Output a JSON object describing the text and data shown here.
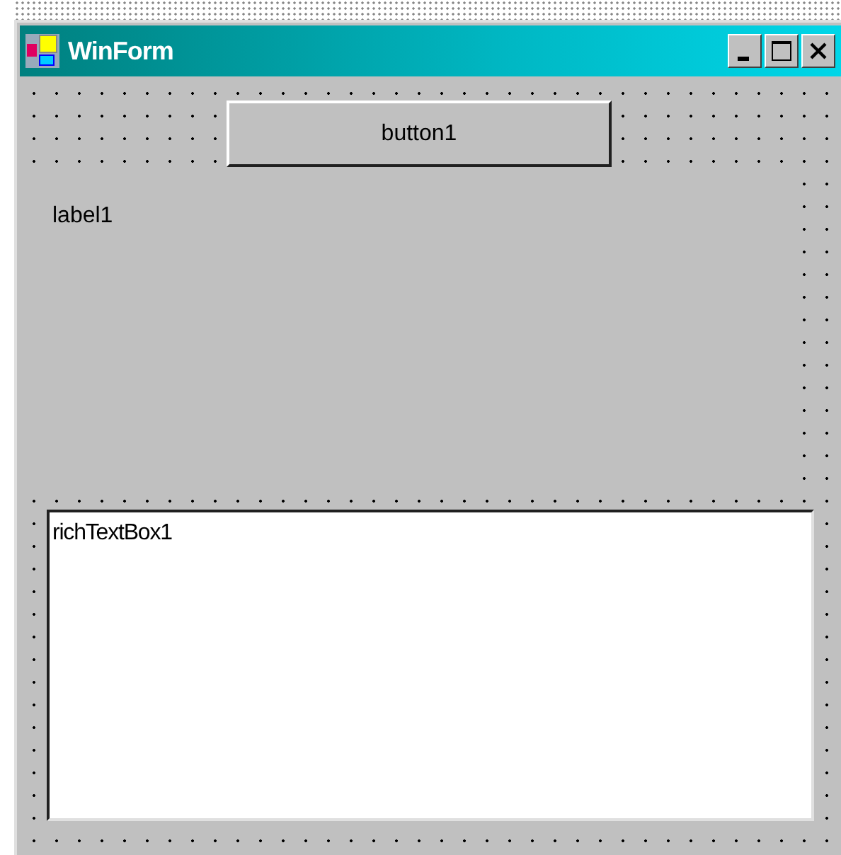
{
  "window": {
    "title": "WinForm"
  },
  "button": {
    "label": "button1"
  },
  "label": {
    "text": "label1"
  },
  "rich_text_box": {
    "value": "richTextBox1"
  }
}
